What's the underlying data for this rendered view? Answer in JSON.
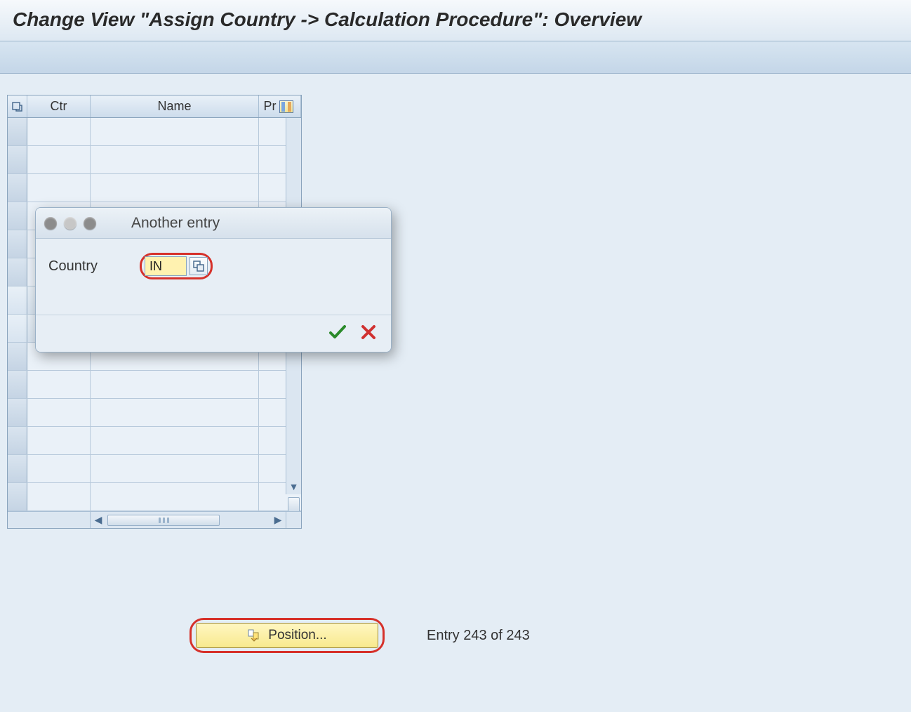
{
  "header": {
    "title": "Change View \"Assign Country -> Calculation Procedure\": Overview"
  },
  "table": {
    "columns": {
      "ctr": "Ctr",
      "name": "Name",
      "pr": "Pr"
    }
  },
  "dialog": {
    "title": "Another entry",
    "label_country": "Country",
    "country_value": "IN"
  },
  "footer": {
    "position_label": "Position...",
    "entry_text": "Entry 243 of 243"
  }
}
